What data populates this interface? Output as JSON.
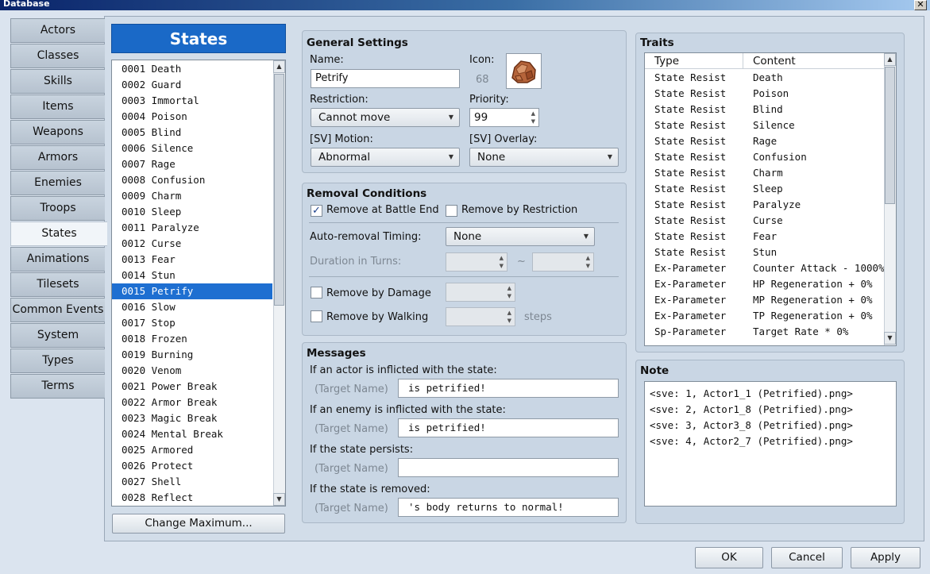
{
  "window": {
    "title": "Database",
    "close_glyph": "✕"
  },
  "categories": [
    "Actors",
    "Classes",
    "Skills",
    "Items",
    "Weapons",
    "Armors",
    "Enemies",
    "Troops",
    "States",
    "Animations",
    "Tilesets",
    "Common Events",
    "System",
    "Types",
    "Terms"
  ],
  "active_category": "States",
  "states_panel": {
    "header": "States",
    "items": [
      "0001 Death",
      "0002 Guard",
      "0003 Immortal",
      "0004 Poison",
      "0005 Blind",
      "0006 Silence",
      "0007 Rage",
      "0008 Confusion",
      "0009 Charm",
      "0010 Sleep",
      "0011 Paralyze",
      "0012 Curse",
      "0013 Fear",
      "0014 Stun",
      "0015 Petrify",
      "0016 Slow",
      "0017 Stop",
      "0018 Frozen",
      "0019 Burning",
      "0020 Venom",
      "0021 Power Break",
      "0022 Armor Break",
      "0023 Magic Break",
      "0024 Mental Break",
      "0025 Armored",
      "0026 Protect",
      "0027 Shell",
      "0028 Reflect"
    ],
    "selected": "0015 Petrify",
    "change_max_label": "Change Maximum..."
  },
  "general": {
    "title": "General Settings",
    "name_label": "Name:",
    "name_value": "Petrify",
    "icon_label": "Icon:",
    "icon_index": "68",
    "restriction_label": "Restriction:",
    "restriction_value": "Cannot move",
    "priority_label": "Priority:",
    "priority_value": "99",
    "motion_label": "[SV] Motion:",
    "motion_value": "Abnormal",
    "overlay_label": "[SV] Overlay:",
    "overlay_value": "None"
  },
  "removal": {
    "title": "Removal Conditions",
    "battle_end_label": "Remove at Battle End",
    "battle_end_checked": true,
    "by_restriction_label": "Remove by Restriction",
    "by_restriction_checked": false,
    "timing_label": "Auto-removal Timing:",
    "timing_value": "None",
    "duration_label": "Duration in Turns:",
    "tilde": "~",
    "damage_label": "Remove by Damage",
    "damage_checked": false,
    "walking_label": "Remove by Walking",
    "walking_checked": false,
    "steps_label": "steps"
  },
  "messages": {
    "title": "Messages",
    "target_name": "(Target Name)",
    "actor_label": "If an actor is inflicted with the state:",
    "actor_value": "is petrified!",
    "enemy_label": "If an enemy is inflicted with the state:",
    "enemy_value": "is petrified!",
    "persist_label": "If the state persists:",
    "persist_value": "",
    "removed_label": "If the state is removed:",
    "removed_value": "'s body returns to normal!"
  },
  "traits": {
    "title": "Traits",
    "col_type": "Type",
    "col_content": "Content",
    "rows": [
      [
        "State Resist",
        "Death"
      ],
      [
        "State Resist",
        "Poison"
      ],
      [
        "State Resist",
        "Blind"
      ],
      [
        "State Resist",
        "Silence"
      ],
      [
        "State Resist",
        "Rage"
      ],
      [
        "State Resist",
        "Confusion"
      ],
      [
        "State Resist",
        "Charm"
      ],
      [
        "State Resist",
        "Sleep"
      ],
      [
        "State Resist",
        "Paralyze"
      ],
      [
        "State Resist",
        "Curse"
      ],
      [
        "State Resist",
        "Fear"
      ],
      [
        "State Resist",
        "Stun"
      ],
      [
        "Ex-Parameter",
        "Counter Attack - 1000%"
      ],
      [
        "Ex-Parameter",
        "HP Regeneration + 0%"
      ],
      [
        "Ex-Parameter",
        "MP Regeneration + 0%"
      ],
      [
        "Ex-Parameter",
        "TP Regeneration + 0%"
      ],
      [
        "Sp-Parameter",
        "Target Rate * 0%"
      ]
    ]
  },
  "note": {
    "title": "Note",
    "lines": [
      "<sve: 1, Actor1_1 (Petrified).png>",
      "<sve: 2, Actor1_8 (Petrified).png>",
      "<sve: 3, Actor3_8 (Petrified).png>",
      "<sve: 4, Actor2_7 (Petrified).png>"
    ]
  },
  "footer": {
    "ok": "OK",
    "cancel": "Cancel",
    "apply": "Apply"
  },
  "icons": {
    "scroll_up": "▲",
    "scroll_down": "▼",
    "combo_arrow": "▼",
    "check": "✓"
  },
  "colors": {
    "selection": "#1e6fd1",
    "states_header": "#1a69c7"
  }
}
